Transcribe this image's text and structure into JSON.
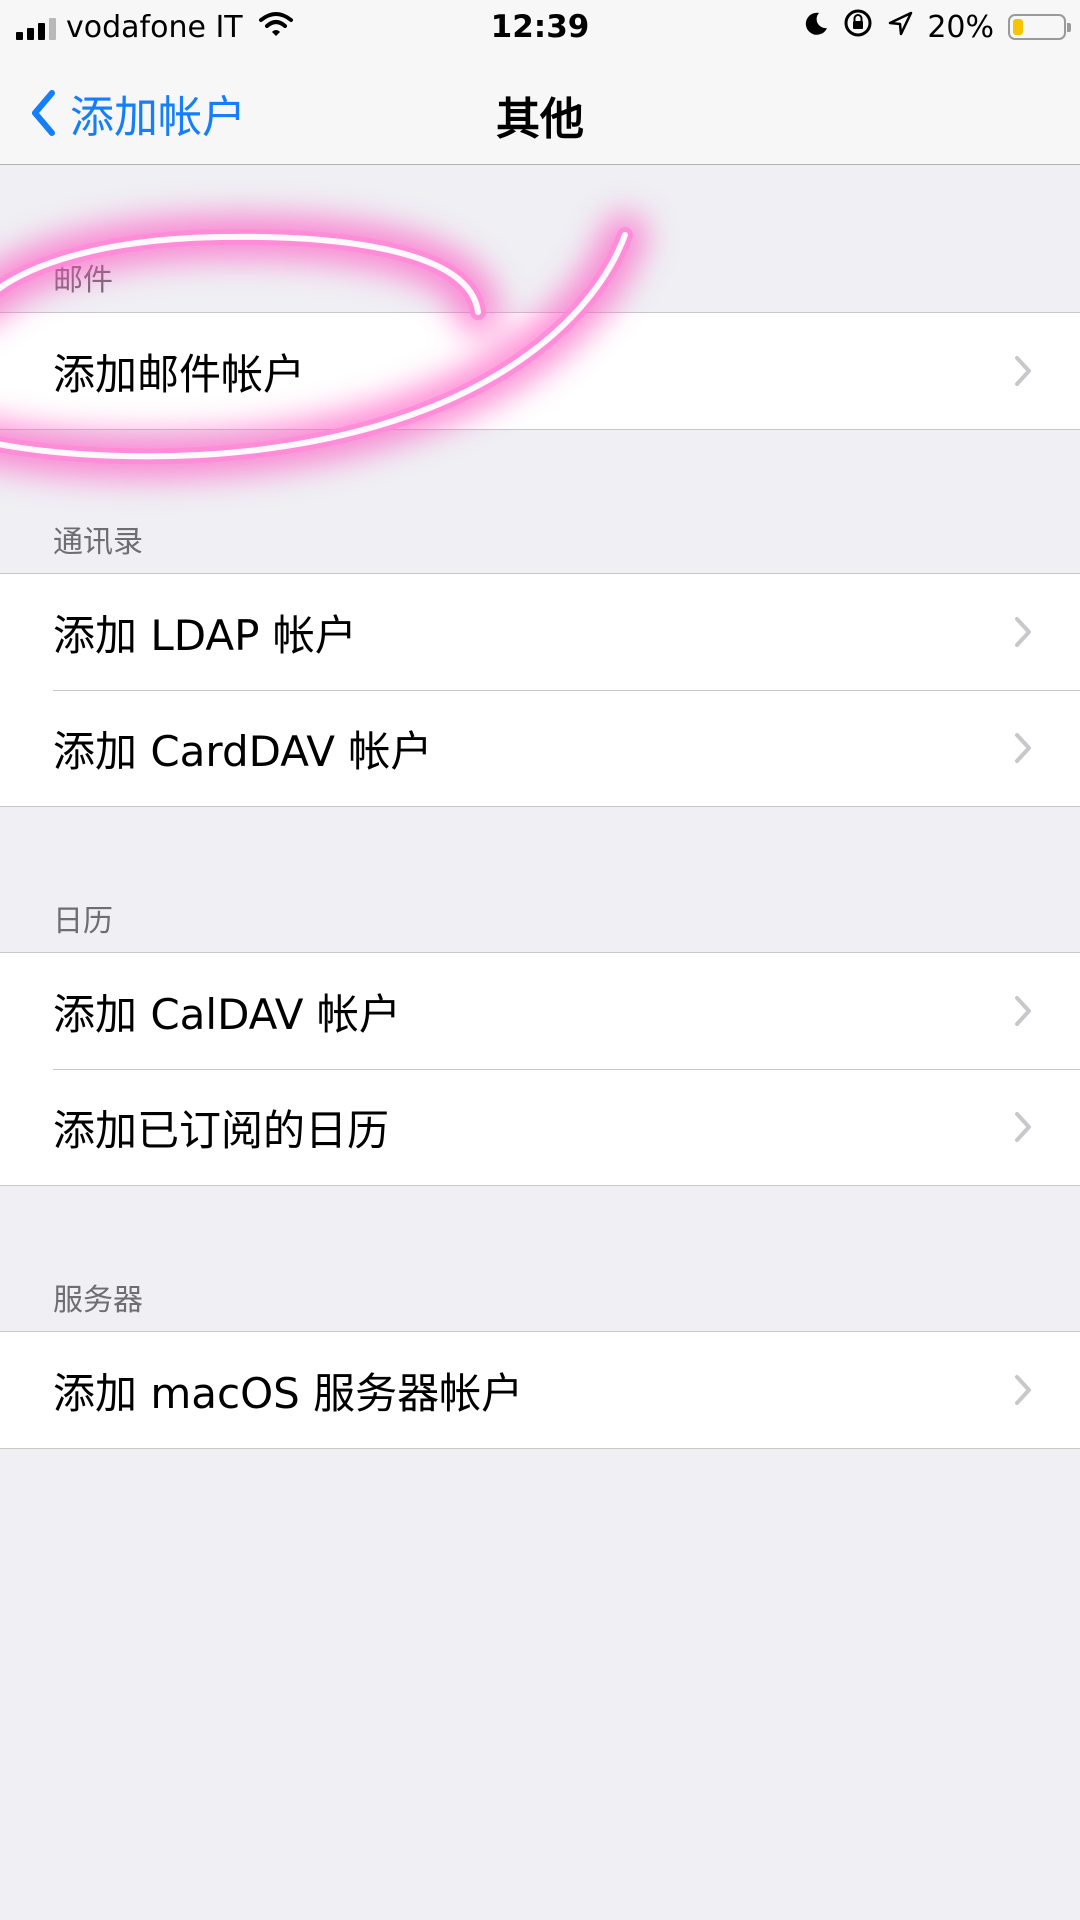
{
  "status_bar": {
    "carrier": "vodafone IT",
    "time": "12:39",
    "battery_percent": "20%",
    "battery_level": 0.2,
    "icons": [
      "signal-icon",
      "wifi-icon",
      "moon-icon",
      "rotation-lock-icon",
      "location-icon",
      "battery-icon"
    ]
  },
  "nav": {
    "back_label": "添加帐户",
    "title": "其他"
  },
  "sections": [
    {
      "header": "邮件",
      "items": [
        "添加邮件帐户"
      ]
    },
    {
      "header": "通讯录",
      "items": [
        "添加 LDAP 帐户",
        "添加 CardDAV 帐户"
      ]
    },
    {
      "header": "日历",
      "items": [
        "添加 CalDAV 帐户",
        "添加已订阅的日历"
      ]
    },
    {
      "header": "服务器",
      "items": [
        "添加 macOS 服务器帐户"
      ]
    }
  ],
  "colors": {
    "accent": "#157efb",
    "highlight": "#ff4fc0",
    "background": "#efeff4"
  }
}
